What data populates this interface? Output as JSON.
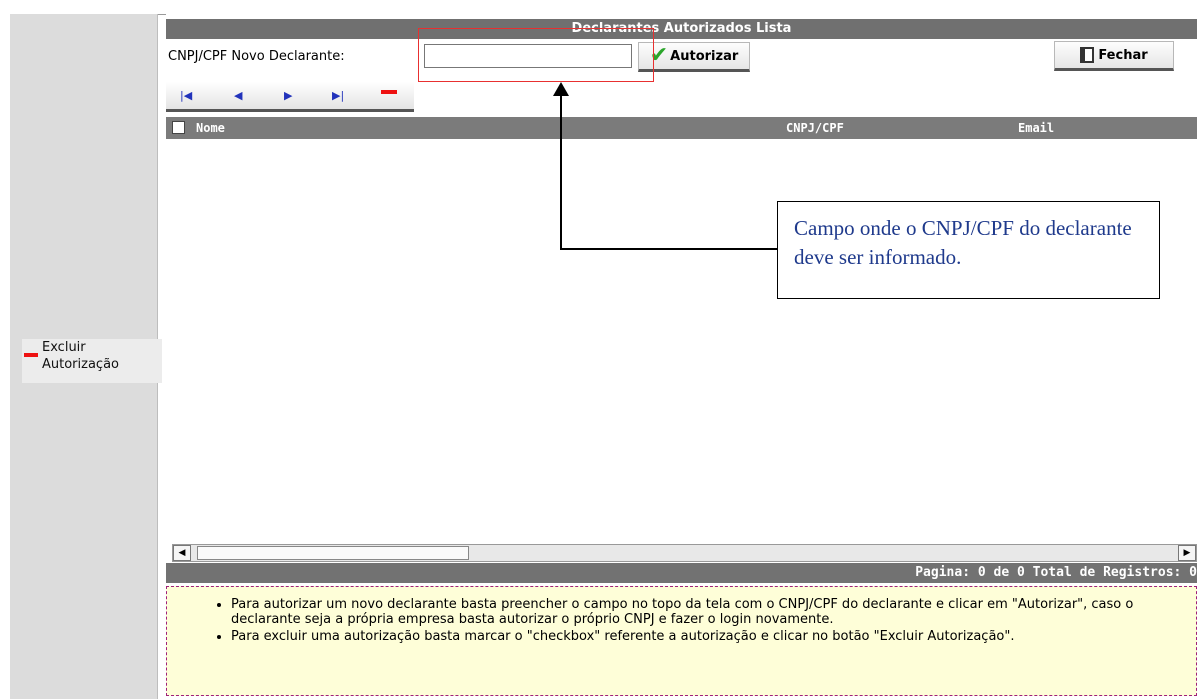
{
  "sidebar": {
    "action_label_1": "Excluir",
    "action_label_2": "Autorização"
  },
  "header": {
    "title": "Declarantes Autorizados Lista"
  },
  "form": {
    "new_label": "CNPJ/CPF Novo Declarante:",
    "input_value": "",
    "authorize_label": "Autorizar",
    "close_label": "Fechar"
  },
  "nav": {
    "first": "first-icon",
    "prev": "prev-icon",
    "next": "next-icon",
    "last": "last-icon",
    "remove": "minus-icon"
  },
  "table": {
    "columns": [
      "Nome",
      "CNPJ/CPF",
      "Email"
    ]
  },
  "footer": {
    "pagination": "Pagina: 0 de 0 Total de Registros: 0"
  },
  "help": {
    "items": [
      "Para autorizar um novo declarante basta preencher o campo no topo da tela com o CNPJ/CPF do declarante e clicar em \"Autorizar\", caso o declarante seja a própria empresa basta autorizar o próprio CNPJ e fazer o login novamente.",
      "Para excluir uma autorização basta marcar o \"checkbox\" referente a autorização e clicar no botão \"Excluir Autorização\"."
    ]
  },
  "callout": {
    "text": "Campo onde o CNPJ/CPF do declarante deve ser informado."
  },
  "colors": {
    "header_gray": "#707070",
    "accent_red": "#ee1111",
    "help_bg": "#fefed8",
    "callout_text": "#1f3a8c"
  }
}
